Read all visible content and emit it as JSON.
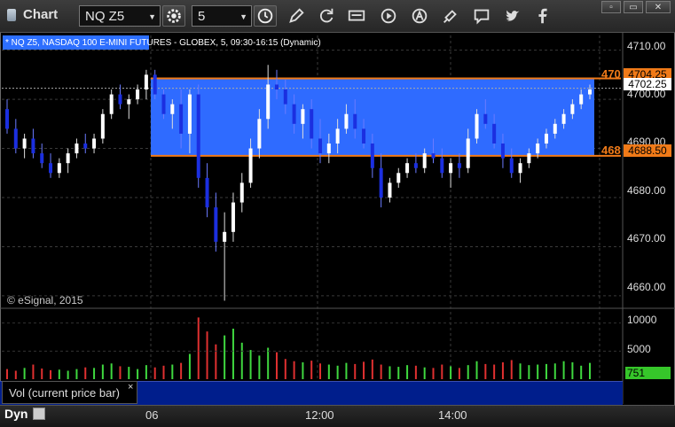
{
  "window": {
    "title": "Chart"
  },
  "toolbar": {
    "symbol": "NQ Z5",
    "interval": "5",
    "icons": [
      "gear-icon",
      "clock-icon",
      "pencil-icon",
      "refresh-icon",
      "get-icon",
      "play-icon",
      "a-icon",
      "link-icon",
      "comment-icon",
      "twitter-icon",
      "facebook-icon"
    ]
  },
  "window_controls": {
    "restore": "▫",
    "minimize": "▭",
    "close": "✕"
  },
  "chart": {
    "symbol_description": "* NQ Z5, NASDAQ 100 E-MINI FUTURES - GLOBEX, 5, 09:30-16:15 (Dynamic)",
    "copyright": "© eSignal, 2015",
    "price_ticks": [
      "4710.00",
      "4700.00",
      "4690.00",
      "4680.00",
      "4670.00",
      "4660.00"
    ],
    "current_price": "4702.25",
    "box_upper": "4704.25",
    "box_lower": "4688.50",
    "box_upper_clipped": "470",
    "box_lower_clipped": "468",
    "colors": {
      "box_fill": "#2f6bff",
      "box_line": "#f07a18",
      "up": "#ffffff",
      "down": "#1b2fe0",
      "vol_up": "#3fd83f",
      "vol_down": "#e03030"
    }
  },
  "volume": {
    "label": "Vol (current price bar)",
    "close_symbol": "×",
    "ticks": [
      "10000",
      "5000",
      "0"
    ],
    "current": "751"
  },
  "time_axis": {
    "mode": "Dyn",
    "labels": [
      "06",
      "12:00",
      "14:00"
    ]
  },
  "chart_data": {
    "type": "candlestick",
    "y_range": [
      4658,
      4713
    ],
    "volume_range": [
      0,
      12000
    ],
    "box_range": [
      4688.5,
      4704.25
    ],
    "candles": [
      [
        4698,
        4700,
        4693,
        4694
      ],
      [
        4694,
        4696,
        4689,
        4690
      ],
      [
        4690,
        4693,
        4688,
        4692
      ],
      [
        4692,
        4694,
        4688,
        4689
      ],
      [
        4689,
        4691,
        4686,
        4687
      ],
      [
        4687,
        4689,
        4684,
        4685
      ],
      [
        4685,
        4688,
        4684,
        4687
      ],
      [
        4687,
        4690,
        4685,
        4689
      ],
      [
        4689,
        4692,
        4688,
        4691
      ],
      [
        4691,
        4693,
        4689,
        4690
      ],
      [
        4690,
        4693,
        4689,
        4692
      ],
      [
        4692,
        4698,
        4691,
        4697
      ],
      [
        4697,
        4702,
        4696,
        4701
      ],
      [
        4701,
        4703,
        4698,
        4699
      ],
      [
        4699,
        4701,
        4696,
        4700
      ],
      [
        4700,
        4703,
        4699,
        4702
      ],
      [
        4702,
        4706,
        4700,
        4705
      ],
      [
        4705,
        4706,
        4700,
        4701
      ],
      [
        4701,
        4702,
        4696,
        4697
      ],
      [
        4697,
        4700,
        4694,
        4699
      ],
      [
        4699,
        4702,
        4690,
        4693
      ],
      [
        4693,
        4702,
        4689,
        4701
      ],
      [
        4701,
        4703,
        4682,
        4684
      ],
      [
        4684,
        4687,
        4676,
        4678
      ],
      [
        4678,
        4681,
        4669,
        4671
      ],
      [
        4671,
        4677,
        4659,
        4673
      ],
      [
        4673,
        4681,
        4671,
        4679
      ],
      [
        4679,
        4685,
        4677,
        4683
      ],
      [
        4683,
        4692,
        4682,
        4690
      ],
      [
        4690,
        4698,
        4688,
        4696
      ],
      [
        4696,
        4707,
        4694,
        4703
      ],
      [
        4703,
        4706,
        4700,
        4702
      ],
      [
        4702,
        4704,
        4697,
        4699
      ],
      [
        4699,
        4701,
        4693,
        4695
      ],
      [
        4695,
        4699,
        4692,
        4698
      ],
      [
        4698,
        4700,
        4690,
        4692
      ],
      [
        4692,
        4696,
        4687,
        4689
      ],
      [
        4689,
        4693,
        4687,
        4691
      ],
      [
        4691,
        4696,
        4689,
        4694
      ],
      [
        4694,
        4699,
        4693,
        4697
      ],
      [
        4697,
        4700,
        4692,
        4694
      ],
      [
        4694,
        4696,
        4690,
        4691
      ],
      [
        4691,
        4693,
        4684,
        4686
      ],
      [
        4686,
        4689,
        4678,
        4680
      ],
      [
        4680,
        4684,
        4679,
        4683
      ],
      [
        4683,
        4686,
        4682,
        4685
      ],
      [
        4685,
        4688,
        4684,
        4687
      ],
      [
        4687,
        4689,
        4685,
        4686
      ],
      [
        4686,
        4690,
        4685,
        4689
      ],
      [
        4689,
        4692,
        4687,
        4688
      ],
      [
        4688,
        4690,
        4684,
        4685
      ],
      [
        4685,
        4688,
        4682,
        4687
      ],
      [
        4687,
        4689,
        4684,
        4686
      ],
      [
        4686,
        4694,
        4685,
        4692
      ],
      [
        4692,
        4698,
        4691,
        4697
      ],
      [
        4697,
        4700,
        4694,
        4695
      ],
      [
        4695,
        4697,
        4690,
        4691
      ],
      [
        4691,
        4693,
        4686,
        4688
      ],
      [
        4688,
        4690,
        4684,
        4685
      ],
      [
        4685,
        4688,
        4683,
        4687
      ],
      [
        4687,
        4690,
        4686,
        4689
      ],
      [
        4689,
        4692,
        4688,
        4691
      ],
      [
        4691,
        4694,
        4690,
        4693
      ],
      [
        4693,
        4696,
        4692,
        4695
      ],
      [
        4695,
        4698,
        4694,
        4697
      ],
      [
        4697,
        4700,
        4696,
        4699
      ],
      [
        4699,
        4702,
        4698,
        4701
      ],
      [
        4701,
        4703,
        4700,
        4702
      ]
    ],
    "volume": [
      1800,
      1500,
      2000,
      2600,
      1900,
      1600,
      1700,
      1500,
      1800,
      2100,
      2000,
      2600,
      2800,
      2300,
      2200,
      1800,
      2500,
      2100,
      2400,
      2600,
      2900,
      4500,
      11000,
      8500,
      6200,
      7800,
      9000,
      6500,
      5200,
      4200,
      5600,
      4800,
      3600,
      3200,
      3000,
      3300,
      2800,
      2600,
      2400,
      2900,
      2700,
      3100,
      3500,
      2600,
      2300,
      2200,
      2500,
      2400,
      2100,
      2000,
      2600,
      2300,
      2000,
      2500,
      3200,
      2700,
      2600,
      3000,
      3400,
      2800,
      2500,
      2600,
      2700,
      2800,
      3200,
      3000,
      2400,
      2900
    ]
  }
}
